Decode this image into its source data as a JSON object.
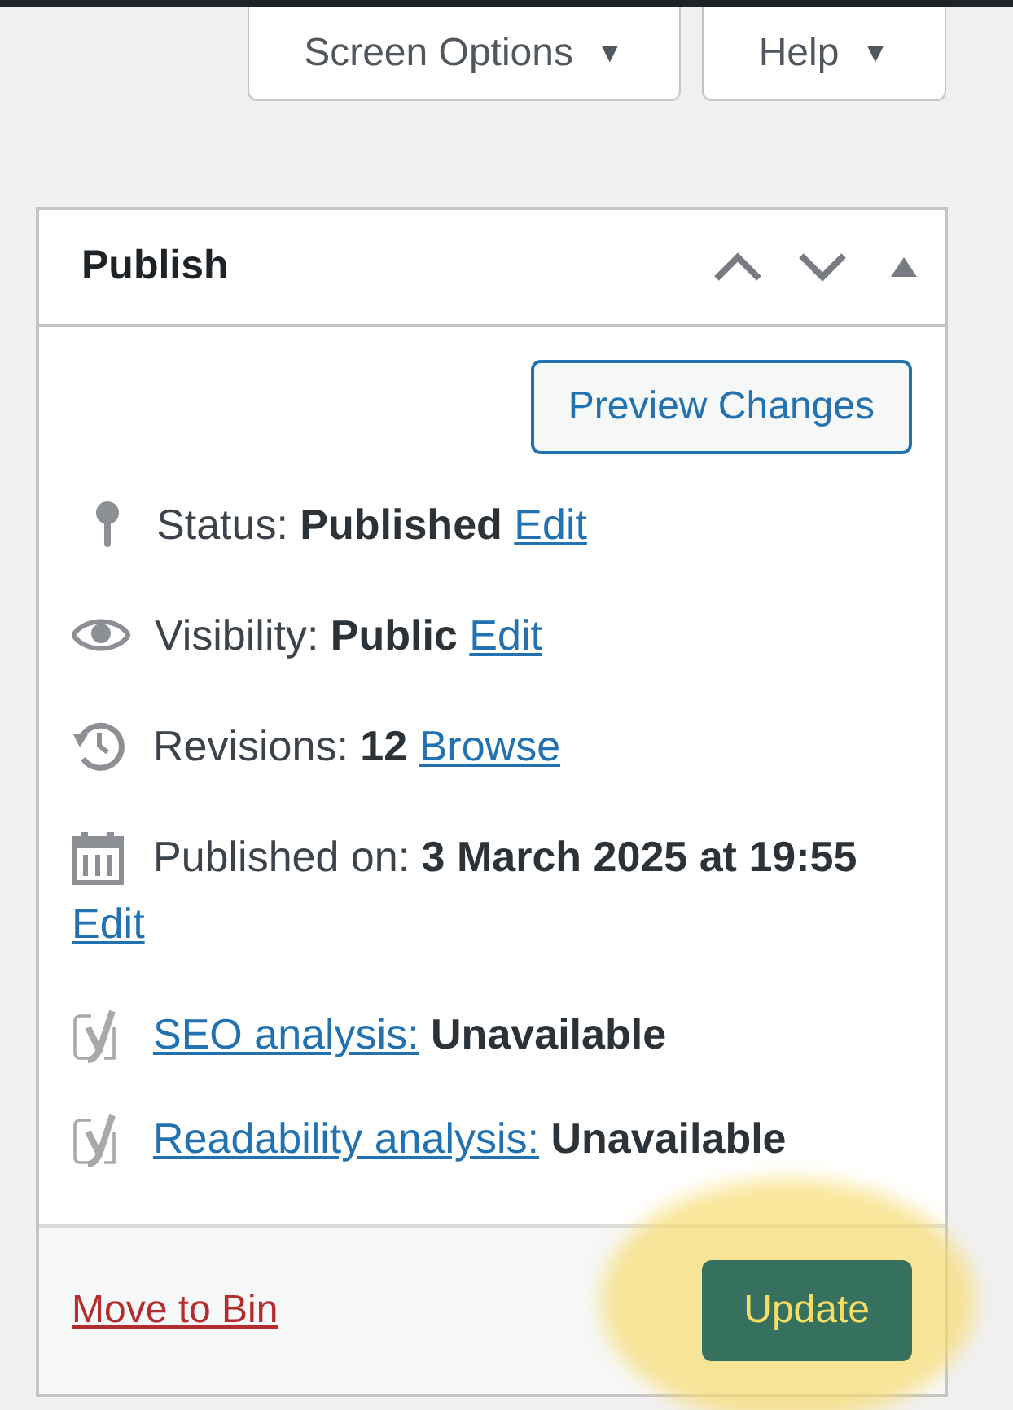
{
  "screen_meta": [
    {
      "label": "Screen Options",
      "caret": "▼"
    },
    {
      "label": "Help",
      "caret": "▼"
    }
  ],
  "publish_box": {
    "title": "Publish",
    "expanded": true,
    "preview_button": "Preview Changes",
    "rows": [
      {
        "kind": "status",
        "label": "Status:",
        "value": "Published",
        "link": "Edit"
      },
      {
        "kind": "visibility",
        "label": "Visibility:",
        "value": "Public",
        "link": "Edit"
      },
      {
        "kind": "revisions",
        "label": "Revisions:",
        "value": "12",
        "link": "Browse"
      },
      {
        "kind": "date",
        "label": "Published on:",
        "value": "3 March 2025 at 19:55",
        "link": "Edit"
      },
      {
        "kind": "analysis",
        "link": "SEO analysis:",
        "value": "Unavailable"
      },
      {
        "kind": "analysis",
        "link": "Readability analysis:",
        "value": "Unavailable"
      }
    ],
    "delete_link": "Move to Bin",
    "update_button": "Update",
    "update_highlighted": true
  }
}
